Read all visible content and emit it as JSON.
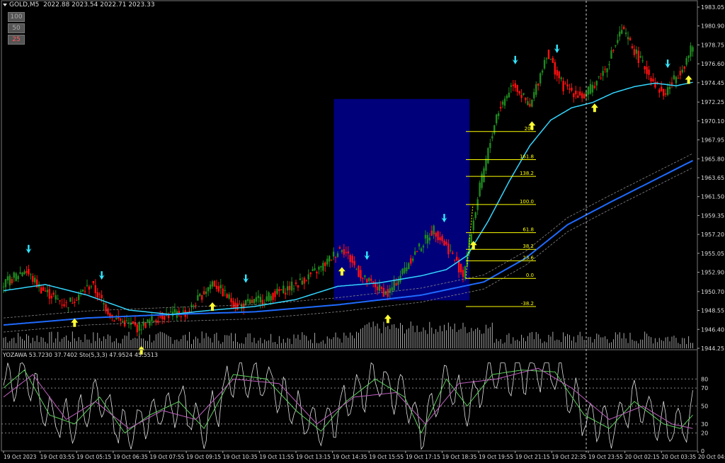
{
  "header": {
    "symbol": "GOLD,M5",
    "ohlc": "2022.88 2023.54 2022.71 2023.33"
  },
  "timeframe_buttons": [
    "100",
    "50",
    "25"
  ],
  "oscillator": {
    "label": "YOZAWA 53.7230 37.7402  Sto(5,3,3) 47.9524 45.5513",
    "levels": [
      80,
      70,
      50,
      30,
      20,
      0
    ]
  },
  "colors": {
    "background": "#000000",
    "bull_bar": "#1f8a1f",
    "bear_bar": "#ff1010",
    "zone": "#00007a",
    "fib": "#ffff00",
    "arrow_up": "#ffff33",
    "arrow_down": "#33e6ff",
    "ma_fast": "#33d6ff",
    "ma_slow": "#1f6bff",
    "volume": "#a8a8a8"
  },
  "chart_data": {
    "type": "candlestick",
    "symbol": "GOLD",
    "timeframe": "M5",
    "y_ticks": [
      "1983.05",
      "1980.90",
      "1978.75",
      "1976.60",
      "1974.45",
      "1972.25",
      "1970.10",
      "1967.95",
      "1965.80",
      "1963.65",
      "1961.50",
      "1959.35",
      "1957.20",
      "1955.05",
      "1952.90",
      "1950.70",
      "1948.55",
      "1946.40",
      "1944.25"
    ],
    "ylim": [
      1944.25,
      1983.05
    ],
    "x_ticks": [
      "19 Oct 2023",
      "19 Oct 03:55",
      "19 Oct 05:15",
      "19 Oct 06:35",
      "19 Oct 07:55",
      "19 Oct 09:15",
      "19 Oct 10:35",
      "19 Oct 11:55",
      "19 Oct 13:15",
      "19 Oct 14:35",
      "19 Oct 15:55",
      "19 Oct 17:15",
      "19 Oct 18:35",
      "19 Oct 19:55",
      "19 Oct 21:15",
      "19 Oct 22:35",
      "19 Oct 23:55",
      "20 Oct 02:15",
      "20 Oct 03:35",
      "20 Oct 04:55"
    ],
    "fib_levels": [
      {
        "label": "200",
        "price": 1968.9
      },
      {
        "label": "161.8",
        "price": 1965.7
      },
      {
        "label": "138.2",
        "price": 1963.8
      },
      {
        "label": "100.0",
        "price": 1960.6
      },
      {
        "label": "61.8",
        "price": 1957.4
      },
      {
        "label": "38.2",
        "price": 1955.5
      },
      {
        "label": "23.6",
        "price": 1954.2
      },
      {
        "label": "0.0",
        "price": 1952.2
      },
      {
        "label": "-38.2",
        "price": 1949.0
      }
    ],
    "zone": {
      "from": "19 Oct 14:35",
      "to": "19 Oct 19:55",
      "top": 1972.6,
      "bottom": 1949.7
    },
    "series": [
      {
        "name": "close",
        "keypoints": [
          [
            0,
            1951.5
          ],
          [
            10,
            1953.2
          ],
          [
            18,
            1951.0
          ],
          [
            30,
            1949.2
          ],
          [
            42,
            1951.5
          ],
          [
            52,
            1947.8
          ],
          [
            64,
            1946.6
          ],
          [
            76,
            1948.0
          ],
          [
            88,
            1948.3
          ],
          [
            100,
            1951.8
          ],
          [
            112,
            1949.0
          ],
          [
            126,
            1950.0
          ],
          [
            140,
            1951.5
          ],
          [
            152,
            1953.4
          ],
          [
            162,
            1955.8
          ],
          [
            172,
            1952.2
          ],
          [
            184,
            1950.4
          ],
          [
            196,
            1954.8
          ],
          [
            206,
            1957.8
          ],
          [
            214,
            1955.2
          ],
          [
            220,
            1952.6
          ],
          [
            228,
            1962.5
          ],
          [
            236,
            1970.8
          ],
          [
            244,
            1974.5
          ],
          [
            252,
            1971.6
          ],
          [
            260,
            1977.8
          ],
          [
            268,
            1974.0
          ],
          [
            278,
            1972.8
          ],
          [
            288,
            1976.0
          ],
          [
            296,
            1980.5
          ],
          [
            306,
            1976.5
          ],
          [
            316,
            1973.0
          ],
          [
            326,
            1976.6
          ],
          [
            330,
            1978.6
          ]
        ]
      },
      {
        "name": "ma_fast",
        "keypoints": [
          [
            0,
            1950.8
          ],
          [
            20,
            1951.5
          ],
          [
            40,
            1950.3
          ],
          [
            60,
            1948.6
          ],
          [
            80,
            1948.1
          ],
          [
            100,
            1948.6
          ],
          [
            120,
            1949.0
          ],
          [
            140,
            1949.8
          ],
          [
            160,
            1951.3
          ],
          [
            180,
            1951.7
          ],
          [
            200,
            1952.5
          ],
          [
            212,
            1953.2
          ],
          [
            222,
            1954.8
          ],
          [
            232,
            1958.7
          ],
          [
            242,
            1963.2
          ],
          [
            252,
            1967.3
          ],
          [
            262,
            1970.2
          ],
          [
            272,
            1971.6
          ],
          [
            282,
            1972.2
          ],
          [
            292,
            1973.3
          ],
          [
            302,
            1974.0
          ],
          [
            312,
            1974.4
          ],
          [
            322,
            1974.1
          ],
          [
            330,
            1974.5
          ]
        ]
      },
      {
        "name": "ma_slow",
        "keypoints": [
          [
            0,
            1946.9
          ],
          [
            40,
            1947.7
          ],
          [
            80,
            1948.1
          ],
          [
            120,
            1948.4
          ],
          [
            160,
            1949.2
          ],
          [
            200,
            1950.3
          ],
          [
            230,
            1951.8
          ],
          [
            250,
            1954.5
          ],
          [
            270,
            1958.3
          ],
          [
            290,
            1960.8
          ],
          [
            310,
            1963.2
          ],
          [
            330,
            1965.6
          ]
        ]
      },
      {
        "name": "stochastic_main",
        "keypoints": [
          [
            0,
            70
          ],
          [
            10,
            90
          ],
          [
            22,
            40
          ],
          [
            34,
            30
          ],
          [
            46,
            60
          ],
          [
            58,
            20
          ],
          [
            70,
            40
          ],
          [
            84,
            55
          ],
          [
            96,
            25
          ],
          [
            110,
            85
          ],
          [
            126,
            80
          ],
          [
            140,
            45
          ],
          [
            152,
            22
          ],
          [
            164,
            55
          ],
          [
            178,
            80
          ],
          [
            192,
            60
          ],
          [
            200,
            20
          ],
          [
            212,
            80
          ],
          [
            222,
            50
          ],
          [
            234,
            85
          ],
          [
            248,
            90
          ],
          [
            264,
            88
          ],
          [
            278,
            40
          ],
          [
            290,
            25
          ],
          [
            302,
            55
          ],
          [
            316,
            30
          ],
          [
            324,
            25
          ],
          [
            330,
            40
          ]
        ]
      },
      {
        "name": "stochastic_signal",
        "keypoints": [
          [
            0,
            60
          ],
          [
            14,
            85
          ],
          [
            30,
            35
          ],
          [
            44,
            55
          ],
          [
            60,
            25
          ],
          [
            76,
            45
          ],
          [
            92,
            35
          ],
          [
            110,
            80
          ],
          [
            132,
            75
          ],
          [
            150,
            30
          ],
          [
            168,
            60
          ],
          [
            188,
            65
          ],
          [
            202,
            30
          ],
          [
            218,
            75
          ],
          [
            236,
            80
          ],
          [
            256,
            92
          ],
          [
            272,
            70
          ],
          [
            290,
            35
          ],
          [
            306,
            50
          ],
          [
            320,
            30
          ],
          [
            330,
            25
          ]
        ]
      }
    ]
  }
}
